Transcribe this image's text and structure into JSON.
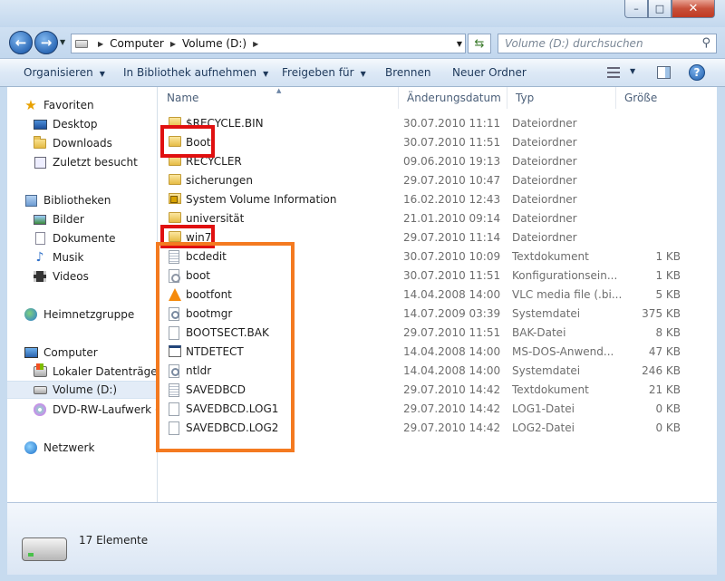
{
  "window": {
    "min_glyph": "–",
    "max_glyph": "□",
    "close_glyph": "✕"
  },
  "address": {
    "crumbs": [
      "Computer",
      "Volume (D:)"
    ],
    "search_placeholder": "Volume (D:) durchsuchen"
  },
  "toolbar": {
    "organize": "Organisieren",
    "include_library": "In Bibliothek aufnehmen",
    "share": "Freigeben für",
    "burn": "Brennen",
    "new_folder": "Neuer Ordner"
  },
  "nav": {
    "favorites": "Favoriten",
    "desktop": "Desktop",
    "downloads": "Downloads",
    "recent": "Zuletzt besucht",
    "libraries": "Bibliotheken",
    "pictures": "Bilder",
    "documents": "Dokumente",
    "music": "Musik",
    "videos": "Videos",
    "homegroup": "Heimnetzgruppe",
    "computer": "Computer",
    "local_disk": "Lokaler Datenträger",
    "volume_d": "Volume (D:)",
    "dvd": "DVD-RW-Laufwerk (",
    "network": "Netzwerk"
  },
  "columns": {
    "name": "Name",
    "date": "Änderungsdatum",
    "type": "Typ",
    "size": "Größe"
  },
  "files": [
    {
      "name": "$RECYCLE.BIN",
      "date": "30.07.2010 11:11",
      "type": "Dateiordner",
      "size": "",
      "icon": "folder"
    },
    {
      "name": "Boot",
      "date": "30.07.2010 11:51",
      "type": "Dateiordner",
      "size": "",
      "icon": "folder"
    },
    {
      "name": "RECYCLER",
      "date": "09.06.2010 19:13",
      "type": "Dateiordner",
      "size": "",
      "icon": "folder"
    },
    {
      "name": "sicherungen",
      "date": "29.07.2010 10:47",
      "type": "Dateiordner",
      "size": "",
      "icon": "folder"
    },
    {
      "name": "System Volume Information",
      "date": "16.02.2010 12:43",
      "type": "Dateiordner",
      "size": "",
      "icon": "locked-folder"
    },
    {
      "name": "universität",
      "date": "21.01.2010 09:14",
      "type": "Dateiordner",
      "size": "",
      "icon": "folder"
    },
    {
      "name": "win7",
      "date": "29.07.2010 11:14",
      "type": "Dateiordner",
      "size": "",
      "icon": "folder"
    },
    {
      "name": "bcdedit",
      "date": "30.07.2010 10:09",
      "type": "Textdokument",
      "size": "1 KB",
      "icon": "text-doc"
    },
    {
      "name": "boot",
      "date": "30.07.2010 11:51",
      "type": "Konfigurationsein...",
      "size": "1 KB",
      "icon": "config"
    },
    {
      "name": "bootfont",
      "date": "14.04.2008 14:00",
      "type": "VLC media file (.bi...",
      "size": "5 KB",
      "icon": "vlc"
    },
    {
      "name": "bootmgr",
      "date": "14.07.2009 03:39",
      "type": "Systemdatei",
      "size": "375 KB",
      "icon": "system-file"
    },
    {
      "name": "BOOTSECT.BAK",
      "date": "29.07.2010 11:51",
      "type": "BAK-Datei",
      "size": "8 KB",
      "icon": "blank-doc"
    },
    {
      "name": "NTDETECT",
      "date": "14.04.2008 14:00",
      "type": "MS-DOS-Anwend...",
      "size": "47 KB",
      "icon": "dos-app"
    },
    {
      "name": "ntldr",
      "date": "14.04.2008 14:00",
      "type": "Systemdatei",
      "size": "246 KB",
      "icon": "system-file"
    },
    {
      "name": "SAVEDBCD",
      "date": "29.07.2010 14:42",
      "type": "Textdokument",
      "size": "21 KB",
      "icon": "text-doc"
    },
    {
      "name": "SAVEDBCD.LOG1",
      "date": "29.07.2010 14:42",
      "type": "LOG1-Datei",
      "size": "0 KB",
      "icon": "blank-doc"
    },
    {
      "name": "SAVEDBCD.LOG2",
      "date": "29.07.2010 14:42",
      "type": "LOG2-Datei",
      "size": "0 KB",
      "icon": "blank-doc"
    }
  ],
  "details": {
    "count": "17 Elemente"
  },
  "colors": {
    "highlight_red": "#e01010",
    "highlight_orange": "#f47a20",
    "selection": "#e3ecf7"
  }
}
